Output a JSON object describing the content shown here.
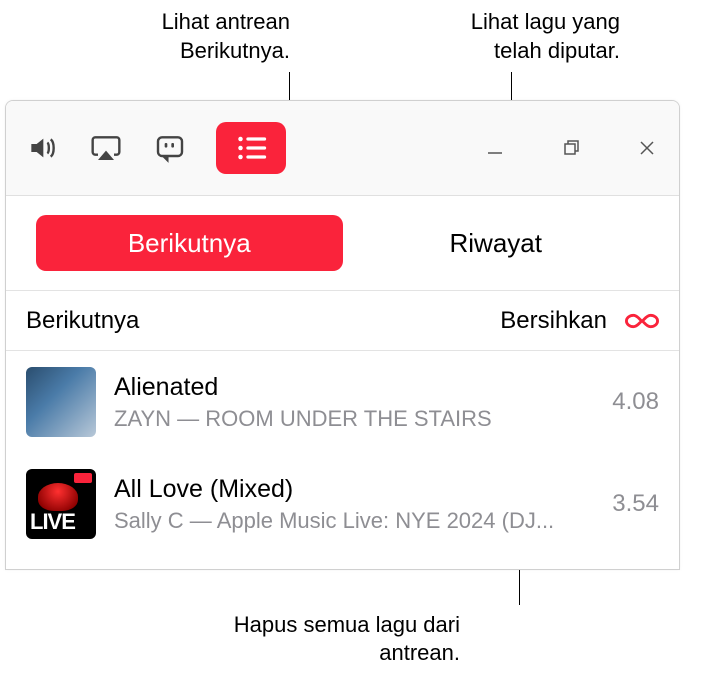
{
  "annotations": {
    "top_left": "Lihat antrean Berikutnya.",
    "top_right": "Lihat lagu yang telah diputar.",
    "bottom": "Hapus semua lagu dari antrean."
  },
  "tabs": {
    "next": "Berikutnya",
    "history": "Riwayat"
  },
  "section": {
    "title": "Berikutnya",
    "clear": "Bersihkan"
  },
  "tracks": [
    {
      "title": "Alienated",
      "artist": "ZAYN — ROOM UNDER THE STAIRS",
      "duration": "4.08"
    },
    {
      "title": "All Love (Mixed)",
      "artist": "Sally C — Apple Music Live: NYE 2024 (DJ...",
      "duration": "3.54"
    }
  ]
}
